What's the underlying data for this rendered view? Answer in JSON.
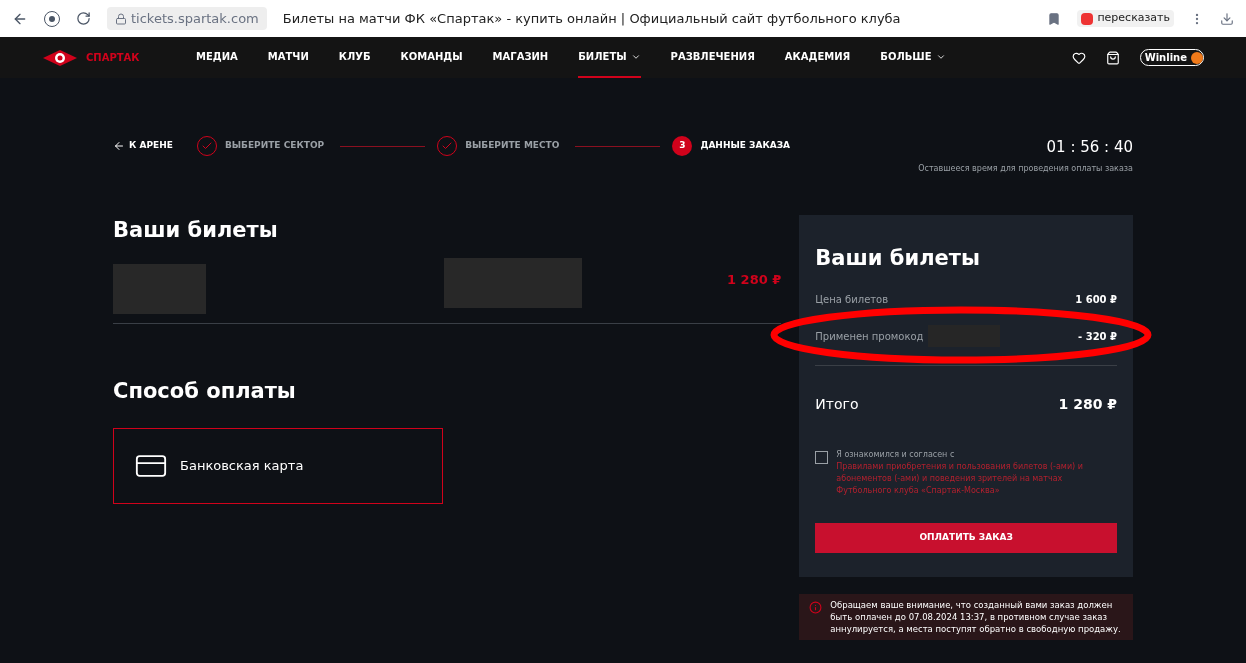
{
  "browser": {
    "url": "tickets.spartak.com",
    "tab_title": "Билеты на матчи ФК «Спартак» - купить онлайн | Официальный сайт футбольного клуба",
    "retell": "пересказать"
  },
  "nav": {
    "logo": "СПАРТАК",
    "items": [
      {
        "label": "МЕДИА",
        "selected": false,
        "dropdown": false
      },
      {
        "label": "МАТЧИ",
        "selected": false,
        "dropdown": false
      },
      {
        "label": "КЛУБ",
        "selected": false,
        "dropdown": false
      },
      {
        "label": "КОМАНДЫ",
        "selected": false,
        "dropdown": false
      },
      {
        "label": "МАГАЗИН",
        "selected": false,
        "dropdown": false
      },
      {
        "label": "БИЛЕТЫ",
        "selected": true,
        "dropdown": true
      },
      {
        "label": "РАЗВЛЕЧЕНИЯ",
        "selected": false,
        "dropdown": false
      },
      {
        "label": "АКАДЕМИЯ",
        "selected": false,
        "dropdown": false
      },
      {
        "label": "БОЛЬШЕ",
        "selected": false,
        "dropdown": true
      }
    ],
    "sponsor": "Winline"
  },
  "back": "К АРЕНЕ",
  "steps": [
    {
      "label": "ВЫБЕРИТЕ СЕКТОР",
      "done": true
    },
    {
      "label": "ВЫБЕРИТЕ МЕСТО",
      "done": true
    },
    {
      "label": "ДАННЫЕ ЗАКАЗА",
      "done": false,
      "number": "3"
    }
  ],
  "timer": {
    "time": "01 : 56 : 40",
    "caption": "Оставшееся время для проведения оплаты заказа"
  },
  "tickets": {
    "title": "Ваши билеты",
    "price": "1 280 ₽"
  },
  "payment": {
    "title": "Способ оплаты",
    "method": "Банковская карта",
    "selected": true
  },
  "summary": {
    "title": "Ваши билеты",
    "rows": [
      {
        "label": "Цена билетов",
        "value": "1 600 ₽"
      },
      {
        "label": "Применен промокод",
        "value": "- 320 ₽"
      }
    ],
    "total_label": "Итого",
    "total": "1 280 ₽",
    "agree_text": "Я ознакомился и согласен с ",
    "agree_link": "Правилами приобретения и пользования билетов (-ами) и абонементов (-ами) и поведения зрителей на матчах Футбольного клуба «Спартак-Москва»",
    "checked": false,
    "pay_button": "ОПЛАТИТЬ ЗАКАЗ"
  },
  "notice": "Обращаем ваше внимание, что созданный вами заказ должен быть оплачен до 07.08.2024 13:37, в противном случае заказ аннулируется, а места поступят обратно в свободную продажу."
}
